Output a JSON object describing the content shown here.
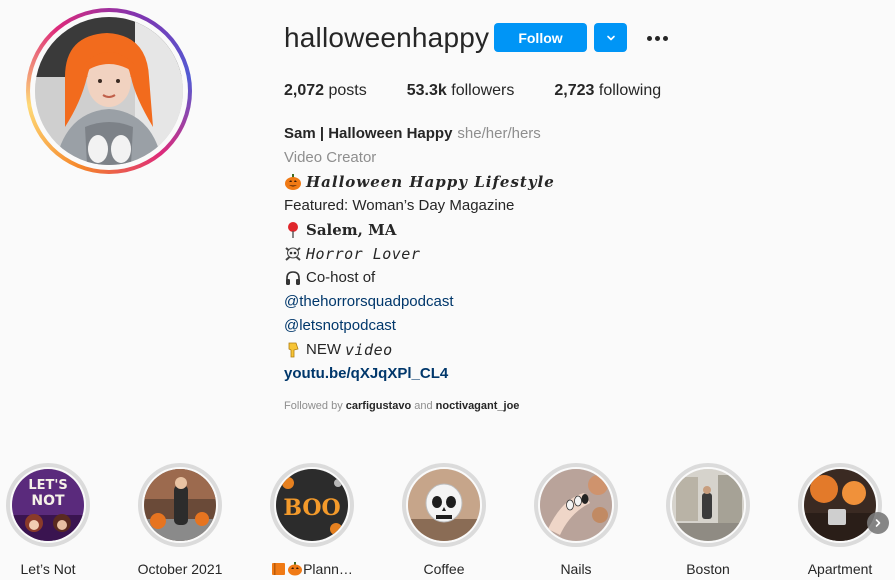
{
  "profile": {
    "username": "halloweenhappy",
    "follow_label": "Follow"
  },
  "stats": {
    "posts_count": "2,072",
    "posts_label": "posts",
    "followers_count": "53.3k",
    "followers_label": "followers",
    "following_count": "2,723",
    "following_label": "following"
  },
  "bio": {
    "name": "Sam | Halloween Happy",
    "pronouns": "she/her/hers",
    "category": "Video Creator",
    "line_tagline": "Halloween Happy Lifestyle",
    "line_featured": "Featured: Woman’s Day Magazine",
    "line_location": "Salem, MA",
    "line_horror": "Horror Lover",
    "line_cohost": "Co-host of",
    "mention_1": "@thehorrorsquadpodcast",
    "mention_2": "@letsnotpodcast",
    "line_new_prefix": "NEW",
    "line_new_suffix": "video",
    "website": "youtu.be/qXJqXPl_CL4"
  },
  "followed_by": {
    "prefix": "Followed by",
    "user_1": "carfigustavo",
    "and": "and",
    "user_2": "noctivagant_joe"
  },
  "highlights": [
    {
      "label": "Let’s Not",
      "img_text": "LET'S NOT"
    },
    {
      "label": "October 2021"
    },
    {
      "label": "Plann…",
      "img_text": "BOO"
    },
    {
      "label": "Coffee"
    },
    {
      "label": "Nails"
    },
    {
      "label": "Boston"
    },
    {
      "label": "Apartment"
    }
  ],
  "colors": {
    "accent": "#0095f6",
    "link": "#00376b",
    "secondary_text": "#8e8e8e",
    "primary_text": "#262626"
  },
  "icons": {
    "more": "more-options-icon",
    "dropdown": "chevron-down-icon",
    "next": "chevron-right-icon"
  }
}
